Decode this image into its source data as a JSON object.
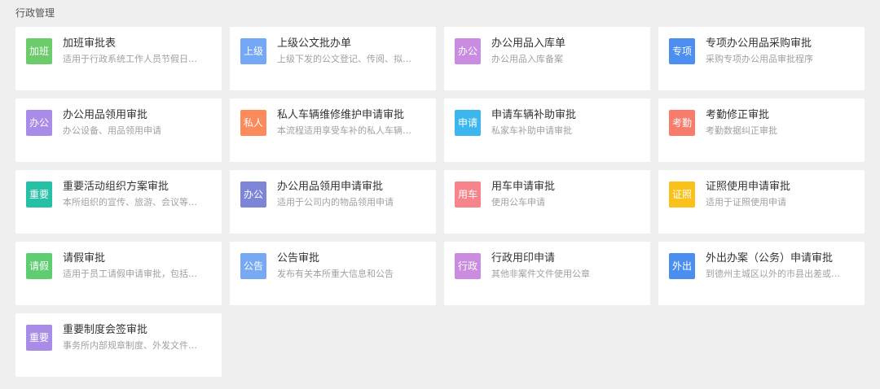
{
  "section": {
    "title": "行政管理"
  },
  "cards": [
    {
      "icon_text": "加班",
      "icon_color": "#6ccb6b",
      "title": "加班审批表",
      "desc": "适用于行政系统工作人员节假日…"
    },
    {
      "icon_text": "上级",
      "icon_color": "#74a7f5",
      "title": "上级公文批办单",
      "desc": "上级下发的公文登记、传阅、拟…"
    },
    {
      "icon_text": "办公",
      "icon_color": "#c98ce0",
      "title": "办公用品入库单",
      "desc": "办公用品入库备案"
    },
    {
      "icon_text": "专项",
      "icon_color": "#4c8ff0",
      "title": "专项办公用品采购审批",
      "desc": "采购专项办公用品审批程序"
    },
    {
      "icon_text": "办公",
      "icon_color": "#a98be8",
      "title": "办公用品领用审批",
      "desc": "办公设备、用品领用申请"
    },
    {
      "icon_text": "私人",
      "icon_color": "#fb8b5b",
      "title": "私人车辆维修维护申请审批",
      "desc": "本流程适用享受车补的私人车辆…"
    },
    {
      "icon_text": "申请",
      "icon_color": "#3bb6ef",
      "title": "申请车辆补助审批",
      "desc": "私家车补助申请审批"
    },
    {
      "icon_text": "考勤",
      "icon_color": "#f77c6c",
      "title": "考勤修正审批",
      "desc": "考勤数据纠正审批"
    },
    {
      "icon_text": "重要",
      "icon_color": "#26c0a6",
      "title": "重要活动组织方案审批",
      "desc": "本所组织的宣传、旅游、会议等…"
    },
    {
      "icon_text": "办公",
      "icon_color": "#7d85d8",
      "title": "办公用品领用申请审批",
      "desc": "适用于公司内的物品领用申请"
    },
    {
      "icon_text": "用车",
      "icon_color": "#f7848a",
      "title": "用车申请审批",
      "desc": "使用公车申请"
    },
    {
      "icon_text": "证照",
      "icon_color": "#f9c11a",
      "title": "证照使用申请审批",
      "desc": "适用于证照使用申请"
    },
    {
      "icon_text": "请假",
      "icon_color": "#5ecd70",
      "title": "请假审批",
      "desc": "适用于员工请假申请审批，包括…"
    },
    {
      "icon_text": "公告",
      "icon_color": "#76a8f3",
      "title": "公告审批",
      "desc": "发布有关本所重大信息和公告"
    },
    {
      "icon_text": "行政",
      "icon_color": "#cb8ce0",
      "title": "行政用印申请",
      "desc": "其他非案件文件使用公章"
    },
    {
      "icon_text": "外出",
      "icon_color": "#4a8fef",
      "title": "外出办案（公务）申请审批",
      "desc": "到德州主城区以外的市县出差或…"
    },
    {
      "icon_text": "重要",
      "icon_color": "#a98be8",
      "title": "重要制度会签审批",
      "desc": "事务所内部规章制度、外发文件…"
    }
  ]
}
